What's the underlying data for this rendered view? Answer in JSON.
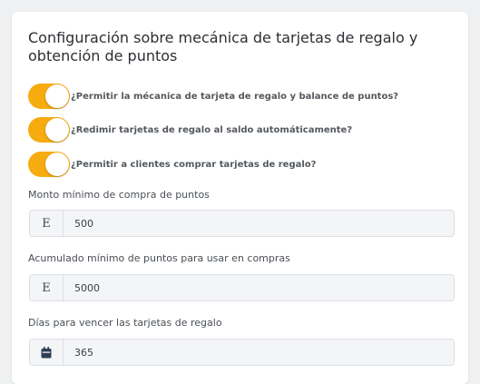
{
  "card": {
    "title": "Configuración sobre mecánica de tarjetas de regalo y obtención de puntos"
  },
  "toggles": [
    {
      "label": "¿Permitir la mécanica de tarjeta de regalo y balance de puntos?",
      "checked": true
    },
    {
      "label": "¿Redimir tarjetas de regalo al saldo automáticamente?",
      "checked": true
    },
    {
      "label": "¿Permitir a clientes comprar tarjetas de regalo?",
      "checked": true
    }
  ],
  "fields": {
    "min_purchase": {
      "label": "Monto mínimo de compra de puntos",
      "addon": "E",
      "value": "500"
    },
    "min_accumulated": {
      "label": "Acumulado mínimo de puntos para usar en compras",
      "addon": "E",
      "value": "5000"
    },
    "expiry_days": {
      "label": "Días para vencer las tarjetas de regalo",
      "addon_icon": "calendar-icon",
      "value": "365"
    }
  },
  "colors": {
    "accent": "#f6ab0f"
  }
}
